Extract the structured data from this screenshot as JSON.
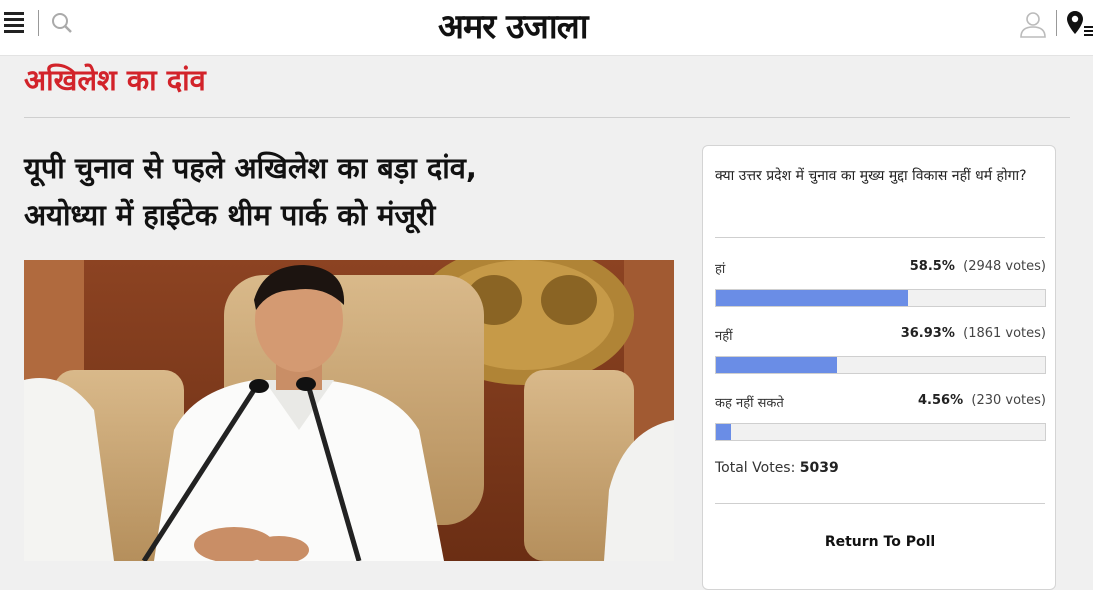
{
  "header": {
    "logo": "अमर उजाला",
    "menu_icon": "hamburger-menu-icon",
    "search_icon": "search-icon",
    "user_icon": "user-icon",
    "location_icon": "location-pin-icon"
  },
  "section": {
    "title": "अखिलेश का दांव",
    "title_color": "#d2232a"
  },
  "article": {
    "headline_line1": "यूपी चुनाव से पहले अखिलेश का बड़ा दांव,",
    "headline_line2": "अयोध्या में हाईटेक थीम पार्क को मंजूरी"
  },
  "poll": {
    "question": "क्या उत्तर प्रदेश में चुनाव का मुख्य मुद्दा विकास नहीं धर्म होगा?",
    "options": [
      {
        "label": "हां",
        "percent": "58.5%",
        "votes": "(2948 votes)",
        "fill": 58.5
      },
      {
        "label": "नहीं",
        "percent": "36.93%",
        "votes": "(1861 votes)",
        "fill": 36.93
      },
      {
        "label": "कह नहीं सकते",
        "percent": "4.56%",
        "votes": "(230 votes)",
        "fill": 4.56
      }
    ],
    "total_label": "Total Votes:",
    "total_value": "5039",
    "return_label": "Return To Poll",
    "bar_color": "#6a8de6"
  }
}
